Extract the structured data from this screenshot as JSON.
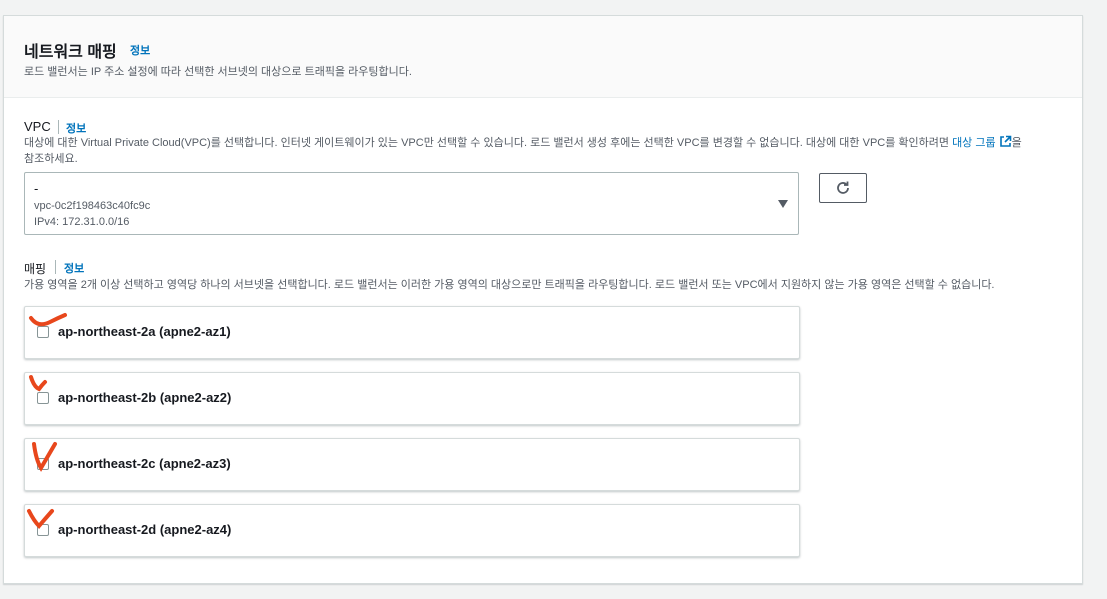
{
  "section": {
    "title": "네트워크 매핑",
    "info": "정보",
    "subtitle": "로드 밸런서는 IP 주소 설정에 따라 선택한 서브넷의 대상으로 트래픽을 라우팅합니다."
  },
  "vpc": {
    "label": "VPC",
    "info": "정보",
    "desc_line1": "대상에 대한 Virtual Private Cloud(VPC)를 선택합니다. 인터넷 게이트웨이가 있는 VPC만 선택할 수 있습니다. 로드 밸런서 생성 후에는 선택한 VPC를 변경할 수 없습니다. 대상에 대한 VPC를 확인하려면 ",
    "desc_link": "대상 그룹",
    "desc_line1_end": "을",
    "desc_line2": "참조하세요.",
    "selected_value": "-",
    "selected_id": "vpc-0c2f198463c40fc9c",
    "selected_cidr": "IPv4: 172.31.0.0/16",
    "link_icon": "external-link-icon",
    "refresh_icon": "refresh-icon",
    "dropdown_icon": "caret-down-icon"
  },
  "mapping": {
    "label": "매핑",
    "info": "정보",
    "desc": "가용 영역을 2개 이상 선택하고 영역당 하나의 서브넷을 선택합니다. 로드 밸런서는 이러한 가용 영역의 대상으로만 트래픽을 라우팅합니다. 로드 밸런서 또는 VPC에서 지원하지 않는 가용 영역은 선택할 수 없습니다.",
    "zones": [
      {
        "label": "ap-northeast-2a (apne2-az1)",
        "checked": false
      },
      {
        "label": "ap-northeast-2b (apne2-az2)",
        "checked": false
      },
      {
        "label": "ap-northeast-2c (apne2-az3)",
        "checked": false
      },
      {
        "label": "ap-northeast-2d (apne2-az4)",
        "checked": false
      }
    ]
  },
  "colors": {
    "link": "#0073bb",
    "annotation": "#e8471c"
  }
}
